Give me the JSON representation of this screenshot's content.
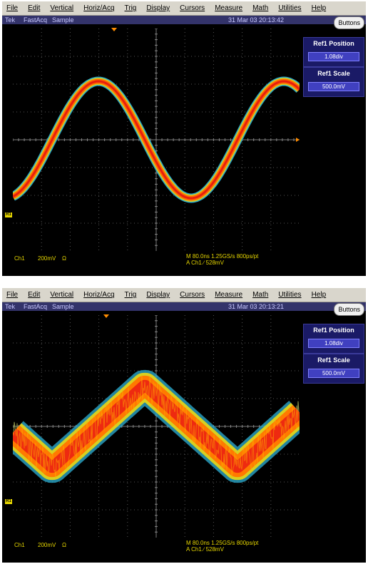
{
  "menu": [
    "File",
    "Edit",
    "Vertical",
    "Horiz/Acq",
    "Trig",
    "Display",
    "Cursors",
    "Measure",
    "Math",
    "Utilities",
    "Help"
  ],
  "panels": [
    {
      "status": {
        "brand": "Tek",
        "mode": "FastAcq",
        "acq": "Sample",
        "datetime": "31 Mar 03 20:13:42"
      },
      "buttons_label": "Buttons",
      "controls": [
        {
          "label": "Ref1 Position",
          "value": "1.08div"
        },
        {
          "label": "Ref1 Scale",
          "value": "500.0mV"
        }
      ],
      "readout": {
        "channel": "Ch1",
        "scale": "200mV",
        "impedance": "Ω",
        "timebase": "M 80.0ns 1.25GS/s  800ps/pt",
        "trigger": "A  Ch1  ∕  528mV"
      },
      "marker_label": "R1",
      "waveform": {
        "shape": "sine",
        "noise": "low"
      }
    },
    {
      "status": {
        "brand": "Tek",
        "mode": "FastAcq",
        "acq": "Sample",
        "datetime": "31 Mar 03 20:13:21"
      },
      "buttons_label": "Buttons",
      "controls": [
        {
          "label": "Ref1 Position",
          "value": "1.08div"
        },
        {
          "label": "Ref1 Scale",
          "value": "500.0mV"
        }
      ],
      "readout": {
        "channel": "Ch1",
        "scale": "200mV",
        "impedance": "Ω",
        "timebase": "M 80.0ns 1.25GS/s  800ps/pt",
        "trigger": "A  Ch1  ∕  528mV"
      },
      "marker_label": "R1",
      "waveform": {
        "shape": "triangle",
        "noise": "high"
      }
    }
  ]
}
